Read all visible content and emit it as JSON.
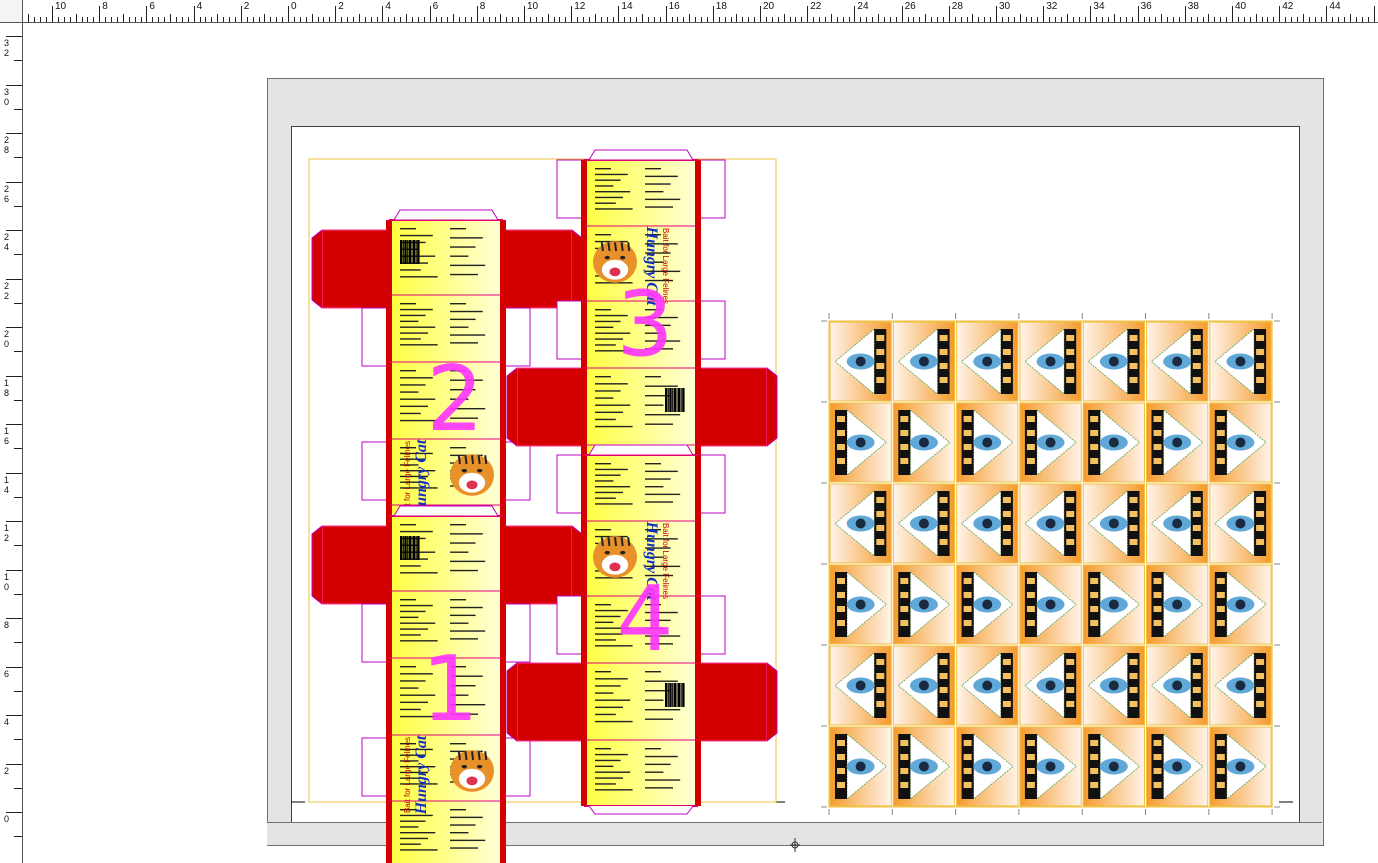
{
  "rulers": {
    "top_labels": [
      "10",
      "8",
      "6",
      "4",
      "2",
      "0",
      "2",
      "4",
      "6",
      "8",
      "10",
      "12",
      "14",
      "16",
      "18",
      "20",
      "22",
      "24",
      "26",
      "28",
      "30",
      "32",
      "34",
      "36",
      "38",
      "40",
      "42",
      "44"
    ],
    "left_labels": [
      "32",
      "30",
      "28",
      "26",
      "24",
      "22",
      "20",
      "18",
      "16",
      "14",
      "12",
      "10",
      "8",
      "6",
      "4",
      "2",
      "0"
    ]
  },
  "boxes": {
    "product_name": "Hungry Cat",
    "tagline": "Bait for Large Felines",
    "numbers": [
      "2",
      "1",
      "3",
      "4"
    ]
  },
  "colors": {
    "box_red": "#d40000",
    "box_yellow": "#ffff40",
    "magenta": "#ff33ff",
    "label_orange": "#f59a2a",
    "trim_gold": "#f0c040"
  },
  "labels_grid": {
    "rows": 6,
    "cols": 7
  }
}
